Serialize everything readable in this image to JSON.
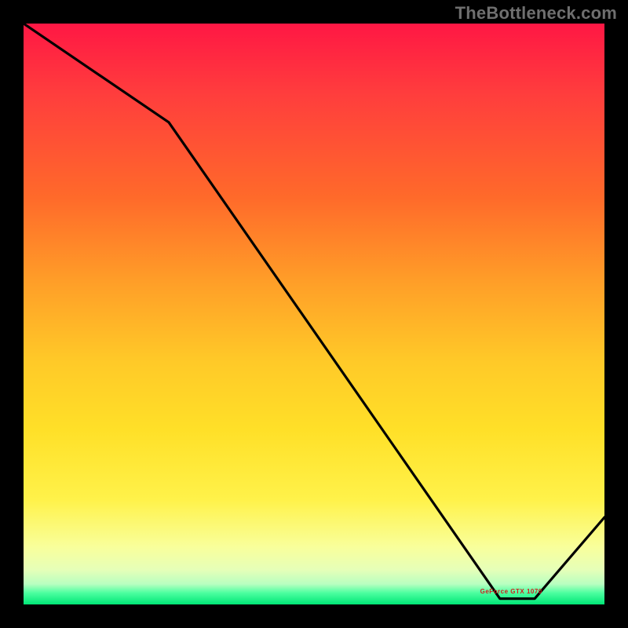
{
  "watermark": "TheBottleneck.com",
  "chart_data": {
    "type": "line",
    "title": "",
    "xlabel": "",
    "ylabel": "",
    "xlim": [
      0,
      100
    ],
    "ylim": [
      0,
      100
    ],
    "grid": false,
    "x": [
      0,
      25,
      82,
      88,
      100
    ],
    "values": [
      100,
      83,
      1,
      1,
      15
    ],
    "annotations": [
      {
        "text": "GeForce GTX 1070",
        "x": 84,
        "y": 2,
        "color": "#d02020"
      }
    ],
    "background_gradient": {
      "direction": "vertical",
      "stops": [
        {
          "pos": 0.0,
          "color": "#ff1744"
        },
        {
          "pos": 0.45,
          "color": "#ffa028"
        },
        {
          "pos": 0.82,
          "color": "#fff24a"
        },
        {
          "pos": 1.0,
          "color": "#00e676"
        }
      ]
    }
  }
}
